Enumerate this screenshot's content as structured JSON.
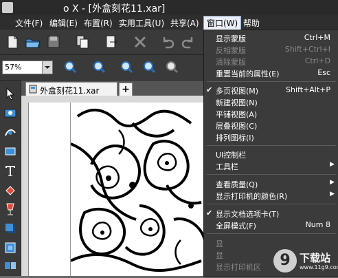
{
  "window": {
    "title": "o X - [外盒刻花11.xar]"
  },
  "menubar": {
    "items": [
      {
        "label": "文件(F)"
      },
      {
        "label": "编辑(E)"
      },
      {
        "label": "布置(R)"
      },
      {
        "label": "实用工具(U)"
      },
      {
        "label": "共享(A)"
      },
      {
        "label": "窗口(W)"
      },
      {
        "label": "帮助"
      }
    ]
  },
  "zoom": {
    "value": "57%"
  },
  "document_tab": {
    "label": "外盒刻花11.xar",
    "new_tab": "+"
  },
  "window_menu": {
    "items": [
      {
        "label": "显示蒙版",
        "shortcut": "Ctrl+M"
      },
      {
        "label": "反相蒙版",
        "shortcut": "Shift+Ctrl+I"
      },
      {
        "label": "清除蒙版",
        "shortcut": "Ctrl+D"
      },
      {
        "label": "重置当前的属性(E)",
        "shortcut": "Esc"
      },
      {
        "label": "多页视图(M)",
        "shortcut": "Shift+Alt+P"
      },
      {
        "label": "新建视图(N)",
        "shortcut": ""
      },
      {
        "label": "平铺视图(A)",
        "shortcut": ""
      },
      {
        "label": "层叠视图(C)",
        "shortcut": ""
      },
      {
        "label": "排列图标(I)",
        "shortcut": ""
      },
      {
        "label": "UI控制栏",
        "shortcut": ""
      },
      {
        "label": "工具栏",
        "shortcut": ""
      },
      {
        "label": "查看质量(Q)",
        "shortcut": ""
      },
      {
        "label": "显示打印机的颜色(R)",
        "shortcut": ""
      },
      {
        "label": "显示文档选项卡(T)",
        "shortcut": ""
      },
      {
        "label": "全屏模式(F)",
        "shortcut": "Num 8"
      },
      {
        "label": "显",
        "shortcut": ""
      },
      {
        "label": "显",
        "shortcut": ""
      },
      {
        "label": "显示打印机区",
        "shortcut": ""
      },
      {
        "label": "",
        "shortcut": ""
      }
    ]
  },
  "watermark": {
    "logo": "9",
    "text": "下载站",
    "url": "www.11g9.com"
  },
  "colors": {
    "title_bar": "#2a2a2a",
    "menu_bg": "#3b3b3b",
    "menu_disabled": "#8a8a8a",
    "canvas": "#ffffff"
  }
}
